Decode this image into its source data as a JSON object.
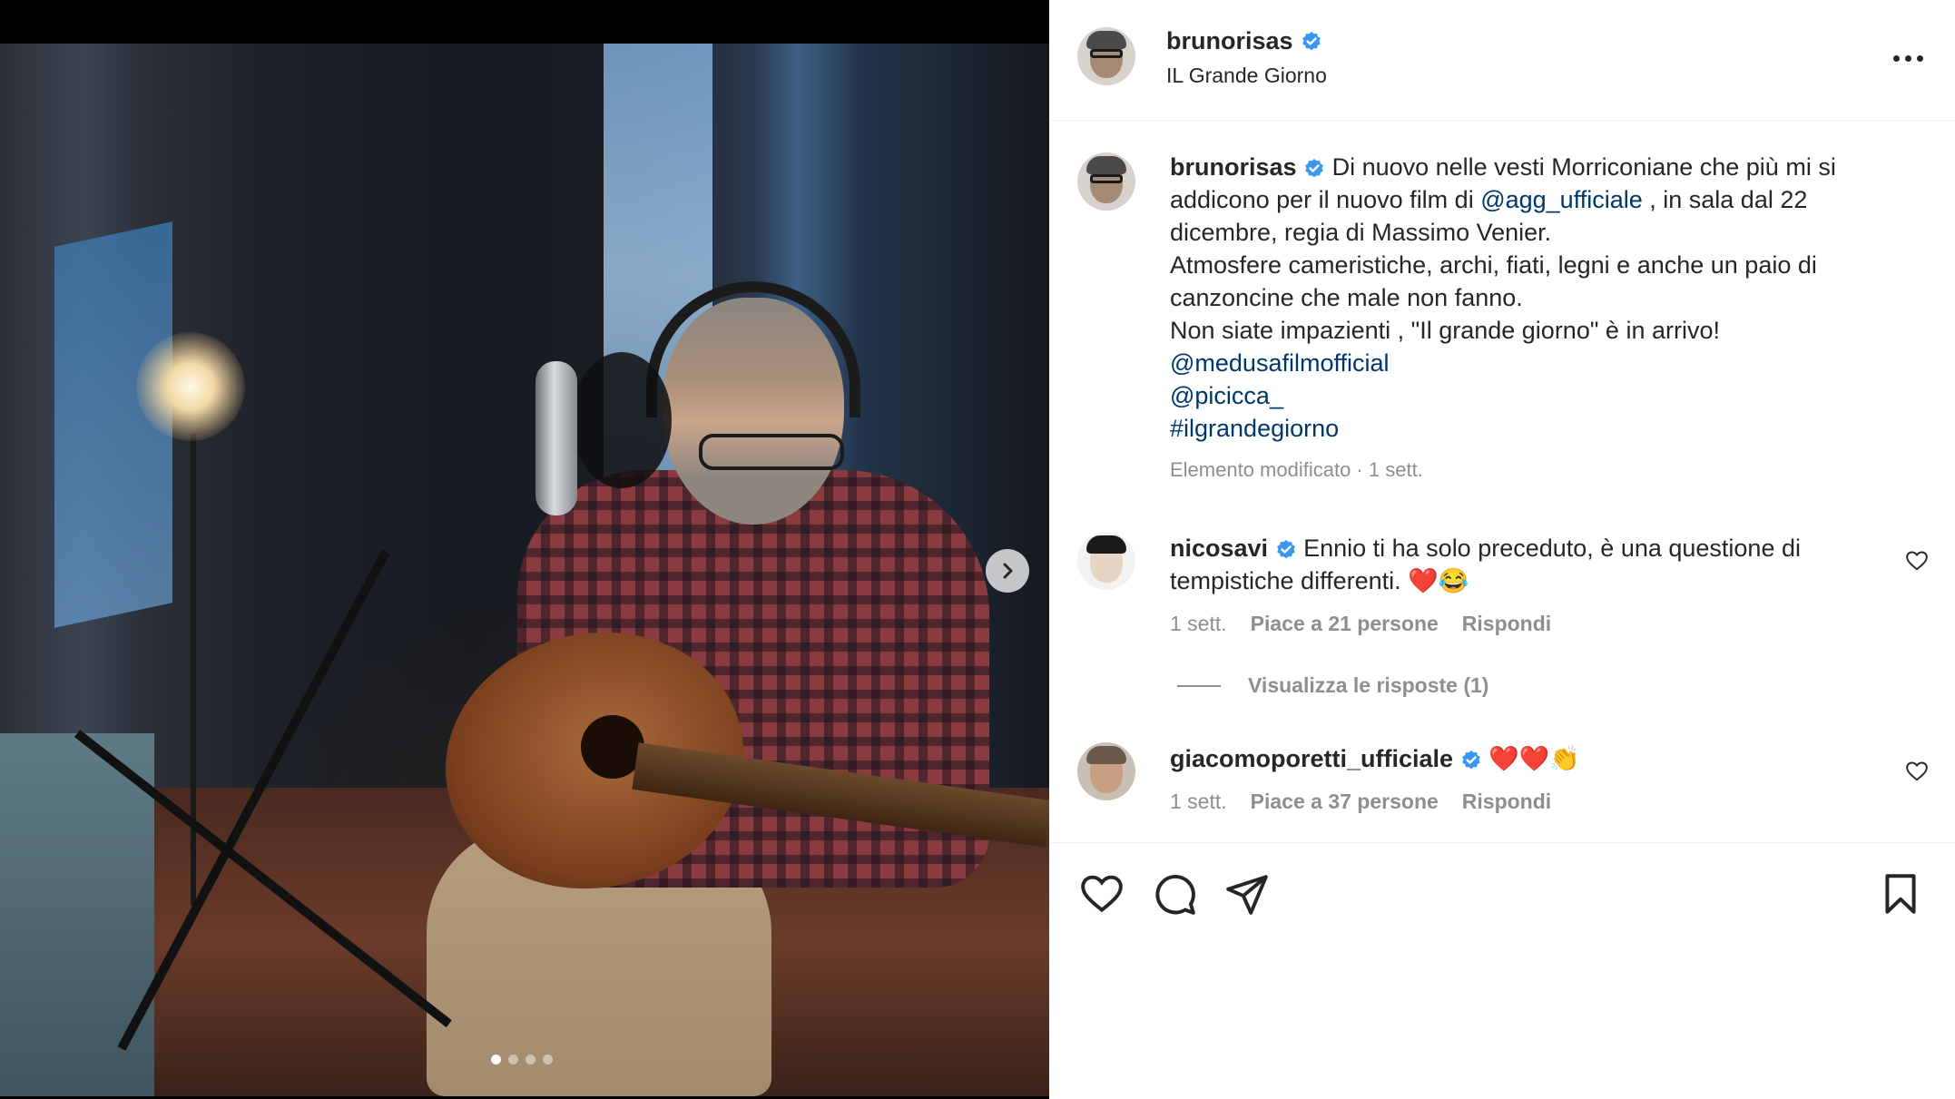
{
  "post": {
    "username": "brunorisas",
    "location": "IL Grande Giorno",
    "caption": {
      "username": "brunorisas",
      "text_1": " Di nuovo nelle vesti Morriconiane che più mi si addicono per il nuovo film di ",
      "mention_1": "@agg_ufficiale",
      "text_2": " , in sala dal 22 dicembre, regia di Massimo Venier.",
      "text_3": "Atmosfere cameristiche, archi, fiati, legni e anche un paio di canzoncine che male non fanno.",
      "text_4": "Non siate impazienti , \"Il grande giorno\" è in arrivo!",
      "mention_2": "@medusafilmofficial",
      "mention_3": "@picicca_",
      "hashtag": "#ilgrandegiorno"
    },
    "edited_label": "Elemento modificato · 1 sett."
  },
  "comments": [
    {
      "username": "nicosavi",
      "text": " Ennio ti ha solo preceduto, è una questione di tempistiche differenti. ❤️😂",
      "time": "1 sett.",
      "likes": "Piace a 21 persone",
      "reply": "Rispondi"
    },
    {
      "username": "giacomoporetti_ufficiale",
      "text": " ❤️❤️👏",
      "time": "1 sett.",
      "likes": "Piace a 37 persone",
      "reply": "Rispondi"
    }
  ],
  "view_replies": "Visualizza le risposte (1)",
  "carousel": {
    "count": 4,
    "active": 1
  },
  "colors": {
    "verified": "#3897f0",
    "mention": "#00376b",
    "muted": "#8e8e8e"
  },
  "icons": [
    "verified-badge-icon",
    "more-icon",
    "heart-icon",
    "comment-icon",
    "share-icon",
    "bookmark-icon",
    "chevron-right-icon"
  ]
}
